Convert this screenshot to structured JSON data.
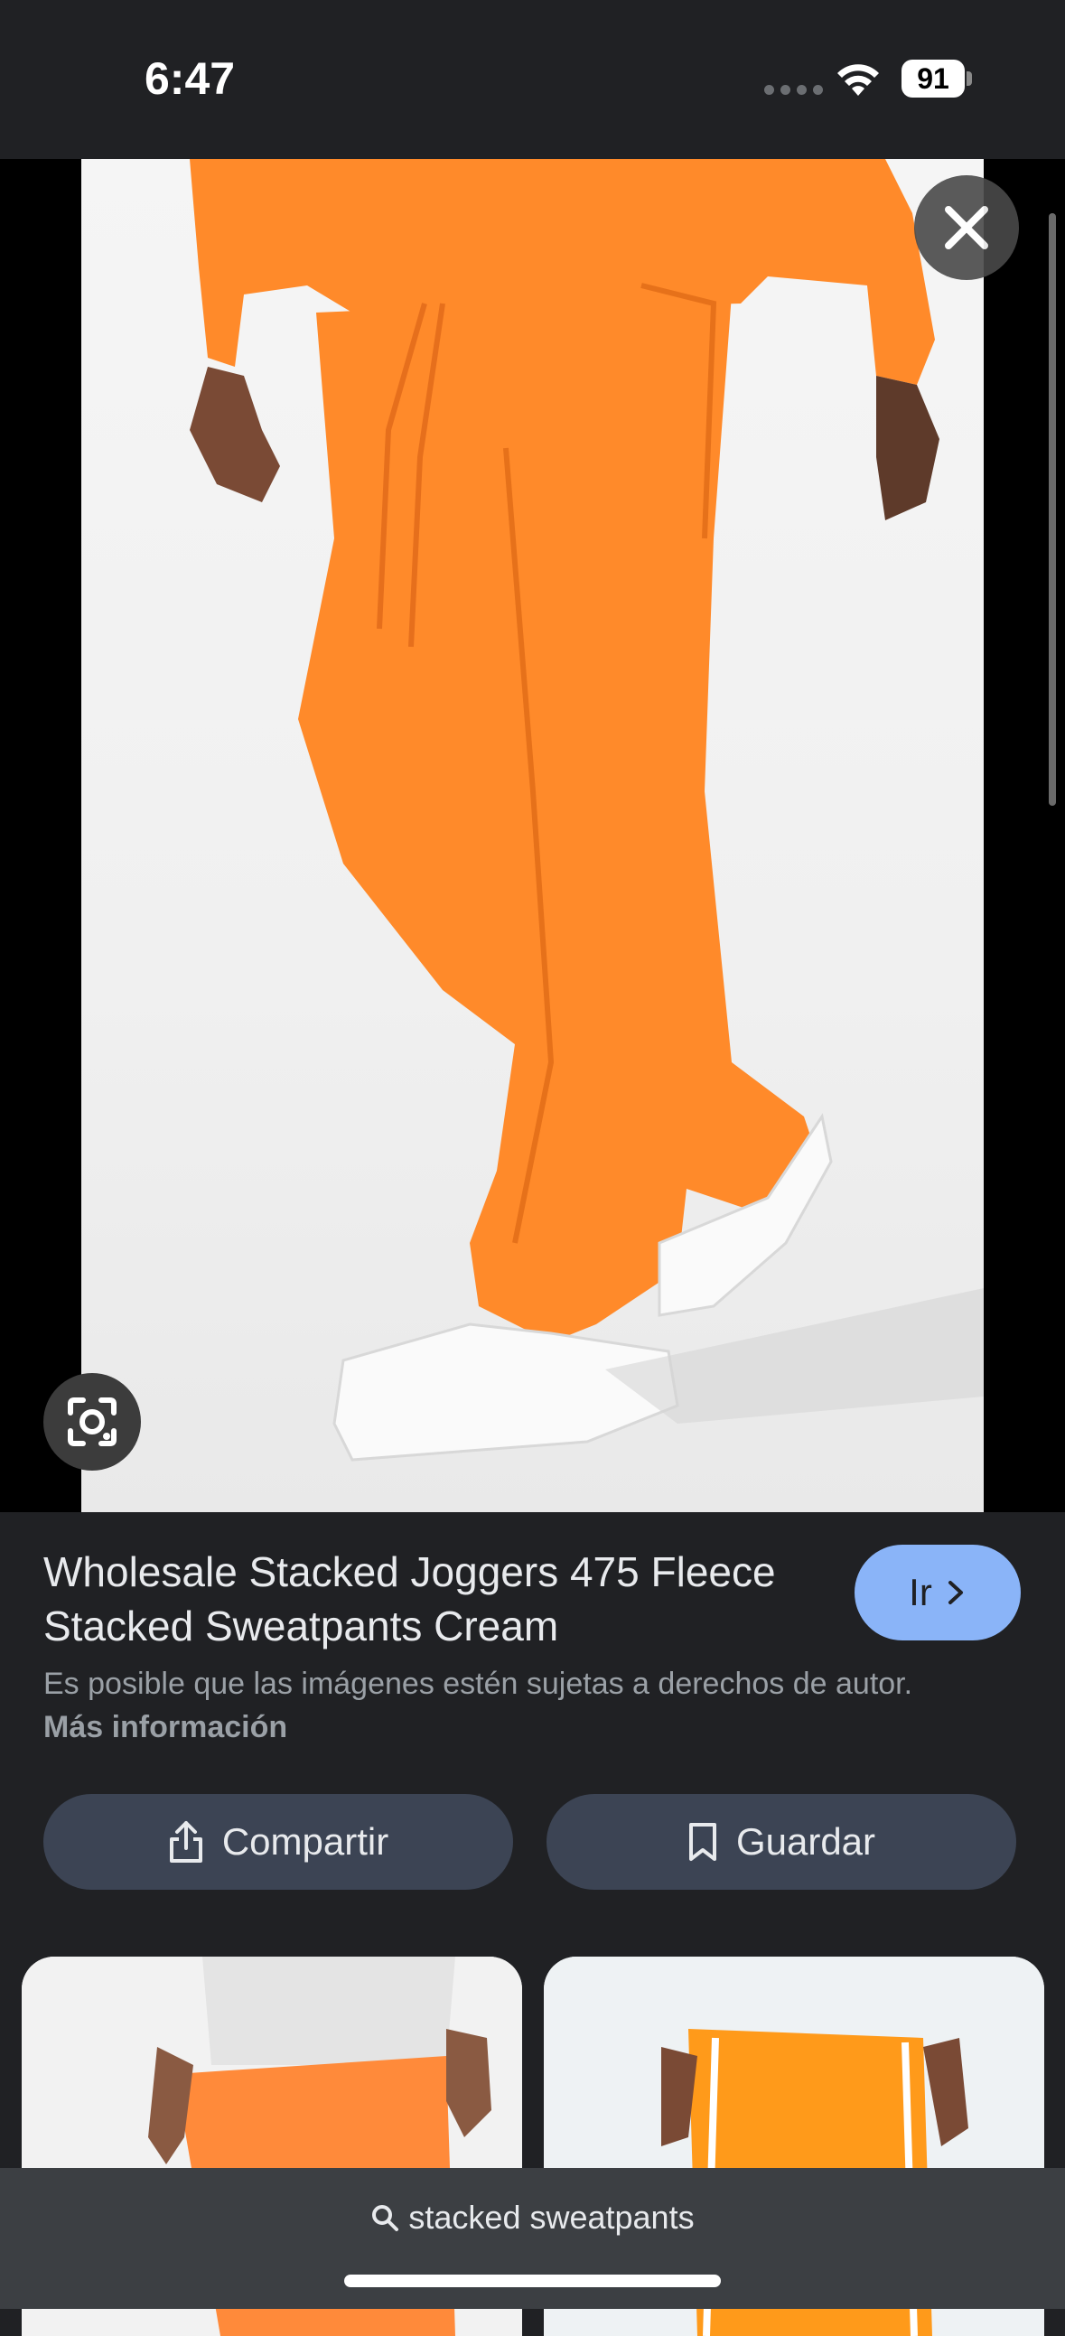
{
  "status_bar": {
    "time": "6:47",
    "battery": "91"
  },
  "viewer": {
    "close_icon": "close-icon",
    "lens_icon": "google-lens-icon"
  },
  "result": {
    "title": "Wholesale Stacked Joggers 475 Fleece Stacked Sweatpants Cream",
    "go_label": "Ir",
    "notice": "Es posible que las imágenes estén sujetas a derechos de autor.",
    "notice_link": "Más información"
  },
  "actions": {
    "share_label": "Compartir",
    "save_label": "Guardar"
  },
  "search": {
    "query": "stacked sweatpants"
  },
  "colors": {
    "accent": "#8ab4f8",
    "background": "#202124",
    "button": "#3c4454",
    "product": "#ff8a2a"
  }
}
